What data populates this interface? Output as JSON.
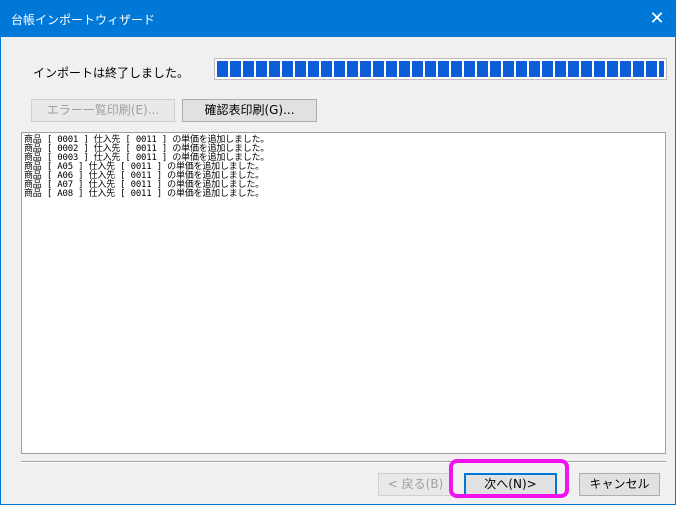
{
  "window": {
    "title": "台帳インポートウィザード",
    "close_label": "✕"
  },
  "status": {
    "text": "インポートは終了しました。",
    "progress_percent": 100
  },
  "toolbar": {
    "error_list_print_label": "エラー一覧印刷(E)...",
    "confirm_print_label": "確認表印刷(G)..."
  },
  "log": {
    "lines": [
      "商品 [ 0001 ] 仕入先 [ 0011 ] の単価を追加しました。",
      "商品 [ 0002 ] 仕入先 [ 0011 ] の単価を追加しました。",
      "商品 [ 0003 ] 仕入先 [ 0011 ] の単価を追加しました。",
      "商品 [ A05 ] 仕入先 [ 0011 ] の単価を追加しました。",
      "商品 [ A06 ] 仕入先 [ 0011 ] の単価を追加しました。",
      "商品 [ A07 ] 仕入先 [ 0011 ] の単価を追加しました。",
      "商品 [ A08 ] 仕入先 [ 0011 ] の単価を追加しました。"
    ]
  },
  "footer": {
    "back_label": "< 戻る(B)",
    "next_label": "次へ(N)>",
    "cancel_label": "キャンセル"
  },
  "colors": {
    "titlebar": "#0078d7",
    "progress": "#0b5ed7",
    "highlight": "#f012f0"
  }
}
